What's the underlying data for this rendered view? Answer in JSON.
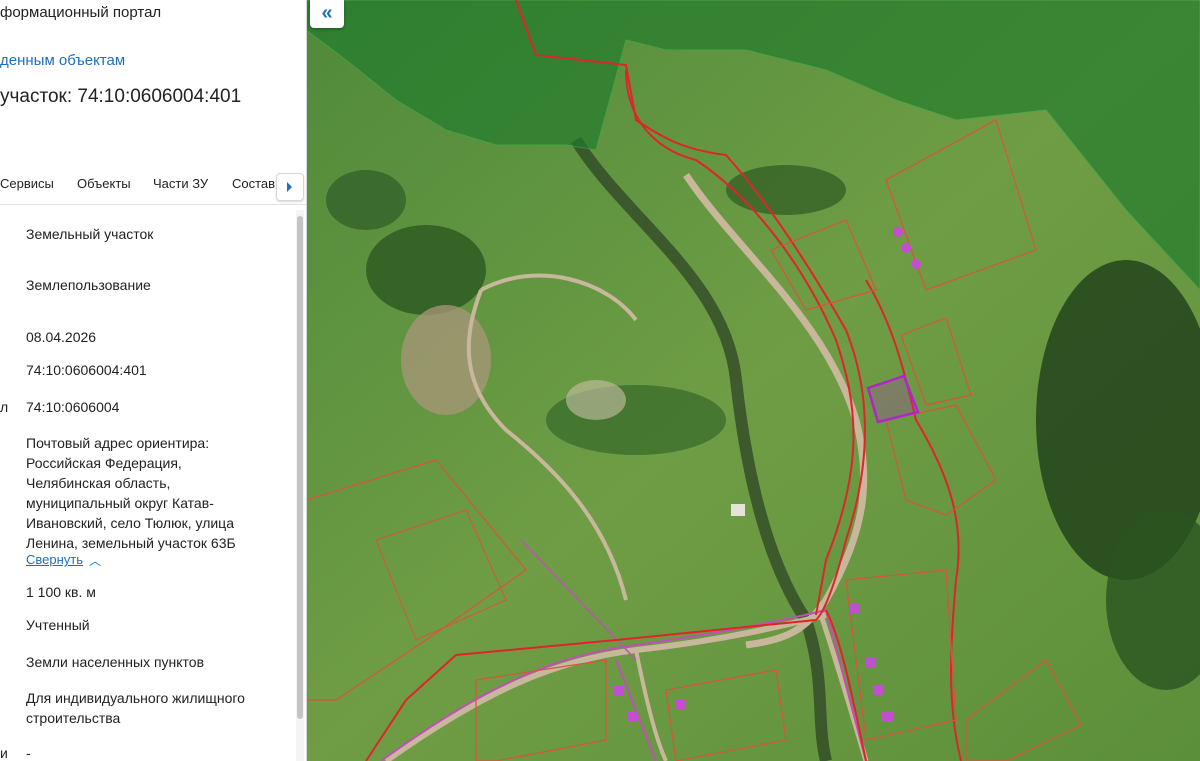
{
  "header": {
    "portal_title": "формационный портал",
    "back_link": "денным объектам",
    "object_title": "участок: 74:10:0606004:401"
  },
  "tabs": [
    {
      "label": "Сервисы"
    },
    {
      "label": "Объекты"
    },
    {
      "label": "Части ЗУ"
    },
    {
      "label": "Состав"
    }
  ],
  "details": {
    "object_type": "Земельный участок",
    "kind": "Землепользование",
    "date": "08.04.2026",
    "cad_number": "74:10:0606004:401",
    "quarter_label_fragment": "л",
    "quarter": "74:10:0606004",
    "address": "Почтовый адрес ориентира: Российская Федерация, Челябинская область, муниципальный округ Катав-Ивановский, село Тюлюк, улица Ленина, земельный участок 63Б",
    "collapse_link": "Свернуть",
    "area": "1 100 кв. м",
    "status": "Учтенный",
    "category": "Земли населенных пунктов",
    "permitted_use": "Для индивидуального жилищного строительства",
    "last_label_fragment": "и",
    "last_value": "-"
  },
  "map": {
    "collapse_button": "«",
    "colors": {
      "forest_overlay": "#1f7a2c",
      "meadow": "#6a9a3c",
      "parcel_outline": "#d9543a",
      "boundary_line": "#e0242a",
      "selected_parcel": "#b026c8",
      "road": "#c8b79a"
    }
  }
}
